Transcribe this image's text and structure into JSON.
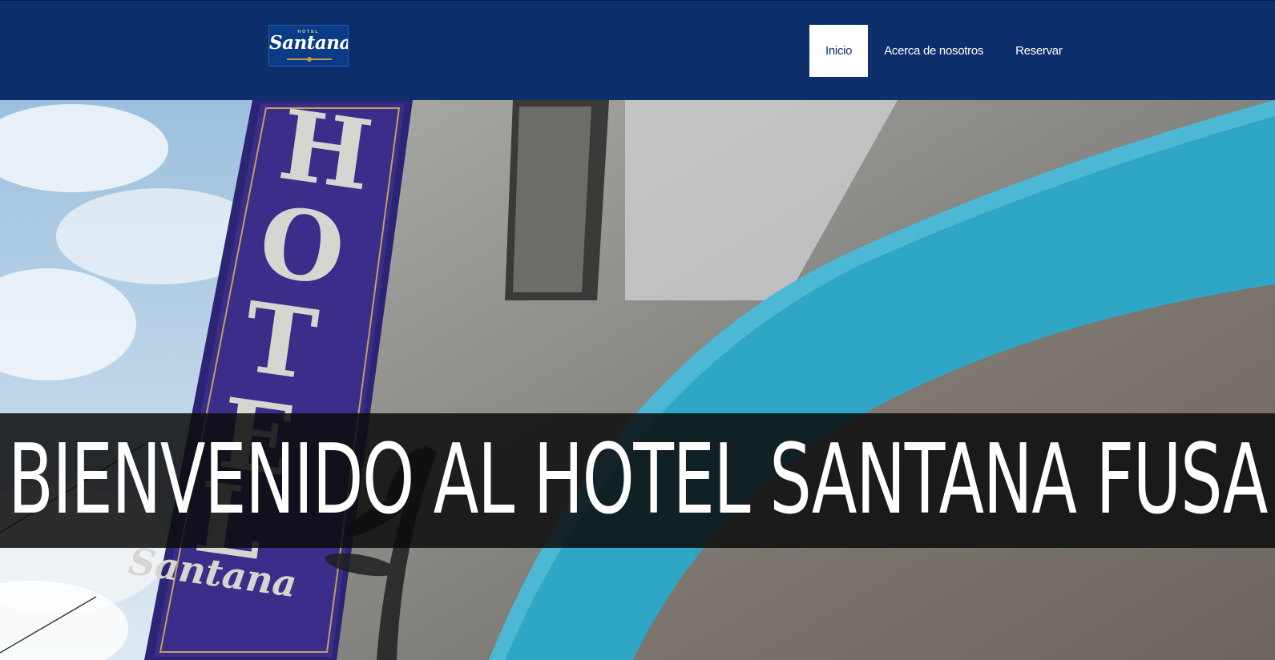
{
  "header": {
    "logo": {
      "small_text": "HOTEL",
      "script_text": "Santana",
      "icon": "hotel-logo"
    },
    "nav": [
      {
        "label": "Inicio",
        "active": true
      },
      {
        "label": "Acerca de nosotros",
        "active": false
      },
      {
        "label": "Reservar",
        "active": false
      }
    ]
  },
  "hero": {
    "title": "BIENVENIDO AL HOTEL SANTANA FUSA",
    "sign_letters": [
      "H",
      "O",
      "T",
      "E",
      "L"
    ],
    "sign_script": "Santana"
  },
  "colors": {
    "nav_bg": "#0d306c",
    "active_tab_bg": "#ffffff",
    "banner_bg": "#0c0c0c",
    "accent_teal": "#2fa6c6",
    "sign_purple": "#3a2e8a"
  }
}
